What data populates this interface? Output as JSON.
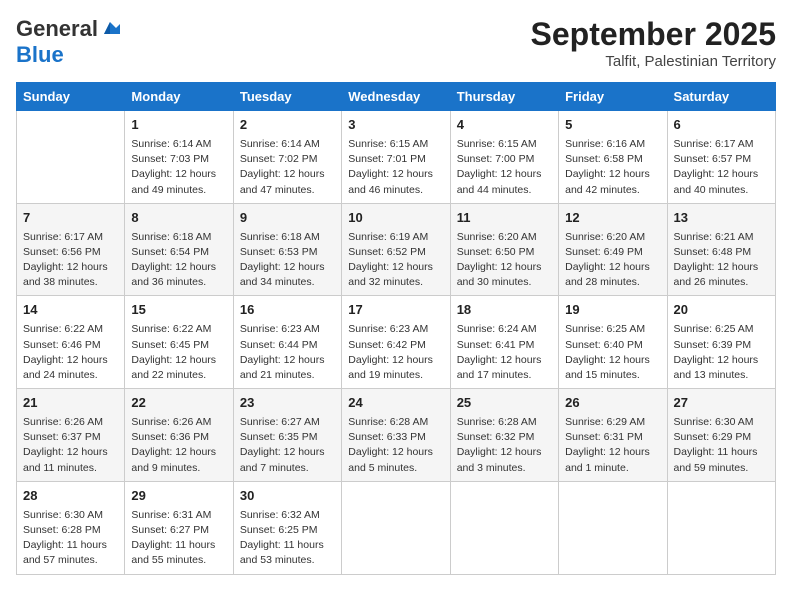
{
  "logo": {
    "line1": "General",
    "line2": "Blue",
    "bird_unicode": "▲"
  },
  "title": "September 2025",
  "subtitle": "Talfit, Palestinian Territory",
  "headers": [
    "Sunday",
    "Monday",
    "Tuesday",
    "Wednesday",
    "Thursday",
    "Friday",
    "Saturday"
  ],
  "weeks": [
    [
      {
        "day": "",
        "info": ""
      },
      {
        "day": "1",
        "info": "Sunrise: 6:14 AM\nSunset: 7:03 PM\nDaylight: 12 hours\nand 49 minutes."
      },
      {
        "day": "2",
        "info": "Sunrise: 6:14 AM\nSunset: 7:02 PM\nDaylight: 12 hours\nand 47 minutes."
      },
      {
        "day": "3",
        "info": "Sunrise: 6:15 AM\nSunset: 7:01 PM\nDaylight: 12 hours\nand 46 minutes."
      },
      {
        "day": "4",
        "info": "Sunrise: 6:15 AM\nSunset: 7:00 PM\nDaylight: 12 hours\nand 44 minutes."
      },
      {
        "day": "5",
        "info": "Sunrise: 6:16 AM\nSunset: 6:58 PM\nDaylight: 12 hours\nand 42 minutes."
      },
      {
        "day": "6",
        "info": "Sunrise: 6:17 AM\nSunset: 6:57 PM\nDaylight: 12 hours\nand 40 minutes."
      }
    ],
    [
      {
        "day": "7",
        "info": "Sunrise: 6:17 AM\nSunset: 6:56 PM\nDaylight: 12 hours\nand 38 minutes."
      },
      {
        "day": "8",
        "info": "Sunrise: 6:18 AM\nSunset: 6:54 PM\nDaylight: 12 hours\nand 36 minutes."
      },
      {
        "day": "9",
        "info": "Sunrise: 6:18 AM\nSunset: 6:53 PM\nDaylight: 12 hours\nand 34 minutes."
      },
      {
        "day": "10",
        "info": "Sunrise: 6:19 AM\nSunset: 6:52 PM\nDaylight: 12 hours\nand 32 minutes."
      },
      {
        "day": "11",
        "info": "Sunrise: 6:20 AM\nSunset: 6:50 PM\nDaylight: 12 hours\nand 30 minutes."
      },
      {
        "day": "12",
        "info": "Sunrise: 6:20 AM\nSunset: 6:49 PM\nDaylight: 12 hours\nand 28 minutes."
      },
      {
        "day": "13",
        "info": "Sunrise: 6:21 AM\nSunset: 6:48 PM\nDaylight: 12 hours\nand 26 minutes."
      }
    ],
    [
      {
        "day": "14",
        "info": "Sunrise: 6:22 AM\nSunset: 6:46 PM\nDaylight: 12 hours\nand 24 minutes."
      },
      {
        "day": "15",
        "info": "Sunrise: 6:22 AM\nSunset: 6:45 PM\nDaylight: 12 hours\nand 22 minutes."
      },
      {
        "day": "16",
        "info": "Sunrise: 6:23 AM\nSunset: 6:44 PM\nDaylight: 12 hours\nand 21 minutes."
      },
      {
        "day": "17",
        "info": "Sunrise: 6:23 AM\nSunset: 6:42 PM\nDaylight: 12 hours\nand 19 minutes."
      },
      {
        "day": "18",
        "info": "Sunrise: 6:24 AM\nSunset: 6:41 PM\nDaylight: 12 hours\nand 17 minutes."
      },
      {
        "day": "19",
        "info": "Sunrise: 6:25 AM\nSunset: 6:40 PM\nDaylight: 12 hours\nand 15 minutes."
      },
      {
        "day": "20",
        "info": "Sunrise: 6:25 AM\nSunset: 6:39 PM\nDaylight: 12 hours\nand 13 minutes."
      }
    ],
    [
      {
        "day": "21",
        "info": "Sunrise: 6:26 AM\nSunset: 6:37 PM\nDaylight: 12 hours\nand 11 minutes."
      },
      {
        "day": "22",
        "info": "Sunrise: 6:26 AM\nSunset: 6:36 PM\nDaylight: 12 hours\nand 9 minutes."
      },
      {
        "day": "23",
        "info": "Sunrise: 6:27 AM\nSunset: 6:35 PM\nDaylight: 12 hours\nand 7 minutes."
      },
      {
        "day": "24",
        "info": "Sunrise: 6:28 AM\nSunset: 6:33 PM\nDaylight: 12 hours\nand 5 minutes."
      },
      {
        "day": "25",
        "info": "Sunrise: 6:28 AM\nSunset: 6:32 PM\nDaylight: 12 hours\nand 3 minutes."
      },
      {
        "day": "26",
        "info": "Sunrise: 6:29 AM\nSunset: 6:31 PM\nDaylight: 12 hours\nand 1 minute."
      },
      {
        "day": "27",
        "info": "Sunrise: 6:30 AM\nSunset: 6:29 PM\nDaylight: 11 hours\nand 59 minutes."
      }
    ],
    [
      {
        "day": "28",
        "info": "Sunrise: 6:30 AM\nSunset: 6:28 PM\nDaylight: 11 hours\nand 57 minutes."
      },
      {
        "day": "29",
        "info": "Sunrise: 6:31 AM\nSunset: 6:27 PM\nDaylight: 11 hours\nand 55 minutes."
      },
      {
        "day": "30",
        "info": "Sunrise: 6:32 AM\nSunset: 6:25 PM\nDaylight: 11 hours\nand 53 minutes."
      },
      {
        "day": "",
        "info": ""
      },
      {
        "day": "",
        "info": ""
      },
      {
        "day": "",
        "info": ""
      },
      {
        "day": "",
        "info": ""
      }
    ]
  ]
}
